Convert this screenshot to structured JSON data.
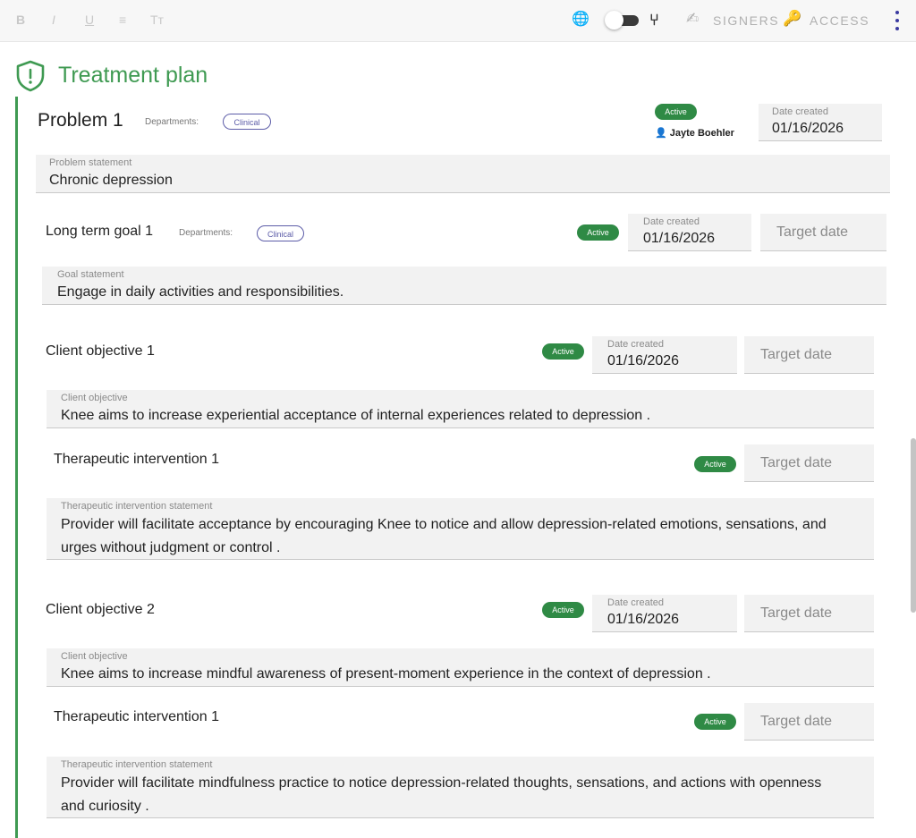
{
  "toolbar": {
    "format_bold": "B",
    "format_italic": "I",
    "format_underline": "U",
    "format_list": "≡",
    "format_size": "Tт",
    "globe_icon": "🌐",
    "branch_icon": "⑂",
    "signers_icon": "✍",
    "signers_label": "SIGNERS",
    "access_icon": "🔑",
    "access_label": "ACCESS"
  },
  "header": {
    "title": "Treatment plan"
  },
  "colors": {
    "accent_green": "#3f9a52",
    "badge_green": "#2f8a45",
    "chip_purple": "#5c5ca8"
  },
  "problem": {
    "title": "Problem 1",
    "departments_label": "Departments:",
    "department_chip": "Clinical",
    "status": "Active",
    "user_icon": "👤",
    "user": "Jayte Boehler",
    "date_created_label": "Date created",
    "date_created": "01/16/2026",
    "statement_label": "Problem statement",
    "statement": "Chronic depression"
  },
  "goal": {
    "title": "Long term goal 1",
    "departments_label": "Departments:",
    "department_chip": "Clinical",
    "status": "Active",
    "date_created_label": "Date created",
    "date_created": "01/16/2026",
    "target_placeholder": "Target date",
    "statement_label": "Goal statement",
    "statement": "Engage in daily activities and responsibilities."
  },
  "objectives": [
    {
      "title": "Client objective 1",
      "status": "Active",
      "date_created_label": "Date created",
      "date_created": "01/16/2026",
      "target_placeholder": "Target date",
      "statement_label": "Client objective",
      "statement": "Knee aims to increase experiential acceptance of internal experiences related to depression .",
      "intervention": {
        "title": "Therapeutic intervention 1",
        "status": "Active",
        "target_placeholder": "Target date",
        "statement_label": "Therapeutic intervention statement",
        "statement": "Provider will facilitate acceptance by encouraging Knee to notice and allow depression-related emotions, sensations, and urges without judgment or control ."
      }
    },
    {
      "title": "Client objective 2",
      "status": "Active",
      "date_created_label": "Date created",
      "date_created": "01/16/2026",
      "target_placeholder": "Target date",
      "statement_label": "Client objective",
      "statement": "Knee aims to increase mindful awareness of present-moment experience in the context of depression .",
      "intervention": {
        "title": "Therapeutic intervention 1",
        "status": "Active",
        "target_placeholder": "Target date",
        "statement_label": "Therapeutic intervention statement",
        "statement": "Provider will facilitate mindfulness practice to notice depression-related thoughts, sensations, and actions with openness and curiosity ."
      }
    }
  ]
}
